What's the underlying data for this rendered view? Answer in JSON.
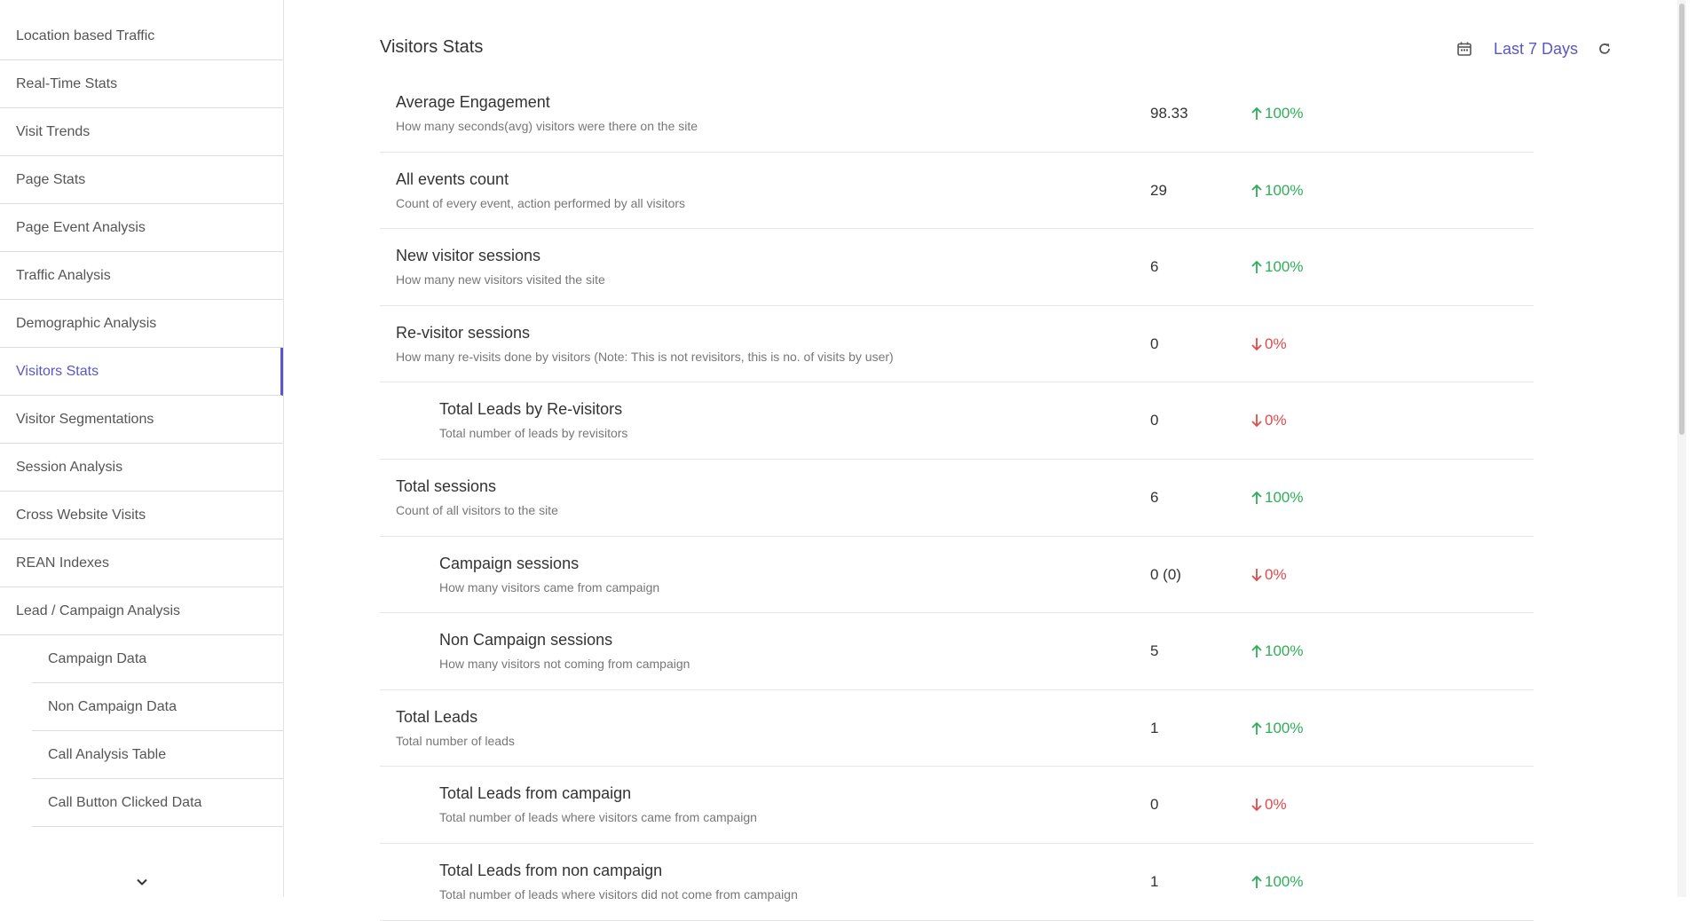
{
  "sidebar": {
    "items": [
      {
        "label": "Location based Traffic"
      },
      {
        "label": "Real-Time Stats"
      },
      {
        "label": "Visit Trends"
      },
      {
        "label": "Page Stats"
      },
      {
        "label": "Page Event Analysis"
      },
      {
        "label": "Traffic Analysis"
      },
      {
        "label": "Demographic Analysis"
      },
      {
        "label": "Visitors Stats"
      },
      {
        "label": "Visitor Segmentations"
      },
      {
        "label": "Session Analysis"
      },
      {
        "label": "Cross Website Visits"
      },
      {
        "label": "REAN Indexes"
      },
      {
        "label": "Lead / Campaign Analysis"
      },
      {
        "label": "Campaign Data"
      },
      {
        "label": "Non Campaign Data"
      },
      {
        "label": "Call Analysis Table"
      },
      {
        "label": "Call Button Clicked Data"
      }
    ],
    "active_item": "Visitors Stats",
    "more_icon": "chevron-down-icon"
  },
  "header": {
    "title": "Visitors Stats",
    "date_range": "Last 7 Days",
    "calendar_icon": "calendar-icon",
    "refresh_icon": "refresh-icon"
  },
  "colors": {
    "accent": "#5a56c7",
    "up": "#2eae57",
    "down": "#e04a4a"
  },
  "stats": [
    {
      "title": "Average Engagement",
      "desc": "How many seconds(avg) visitors were there on the site",
      "value": "98.33",
      "change": "100%",
      "direction": "up"
    },
    {
      "title": "All events count",
      "desc": "Count of every event, action performed by all visitors",
      "value": "29",
      "change": "100%",
      "direction": "up"
    },
    {
      "title": "New visitor sessions",
      "desc": "How many new visitors visited the site",
      "value": "6",
      "change": "100%",
      "direction": "up"
    },
    {
      "title": "Re-visitor sessions",
      "desc": "How many re-visits done by visitors (Note: This is not revisitors, this is no. of visits by user)",
      "value": "0",
      "change": "0%",
      "direction": "down"
    },
    {
      "title": "Total Leads by Re-visitors",
      "desc": "Total number of leads by revisitors",
      "value": "0",
      "change": "0%",
      "direction": "down"
    },
    {
      "title": "Total sessions",
      "desc": "Count of all visitors to the site",
      "value": "6",
      "change": "100%",
      "direction": "up"
    },
    {
      "title": "Campaign sessions",
      "desc": "How many visitors came from campaign",
      "value": "0 (0)",
      "change": "0%",
      "direction": "down"
    },
    {
      "title": "Non Campaign sessions",
      "desc": "How many visitors not coming from campaign",
      "value": "5",
      "change": "100%",
      "direction": "up"
    },
    {
      "title": "Total Leads",
      "desc": "Total number of leads",
      "value": "1",
      "change": "100%",
      "direction": "up"
    },
    {
      "title": "Total Leads from campaign",
      "desc": "Total number of leads where visitors came from campaign",
      "value": "0",
      "change": "0%",
      "direction": "down"
    },
    {
      "title": "Total Leads from non campaign",
      "desc": "Total number of leads where visitors did not come from campaign",
      "value": "1",
      "change": "100%",
      "direction": "up"
    }
  ]
}
